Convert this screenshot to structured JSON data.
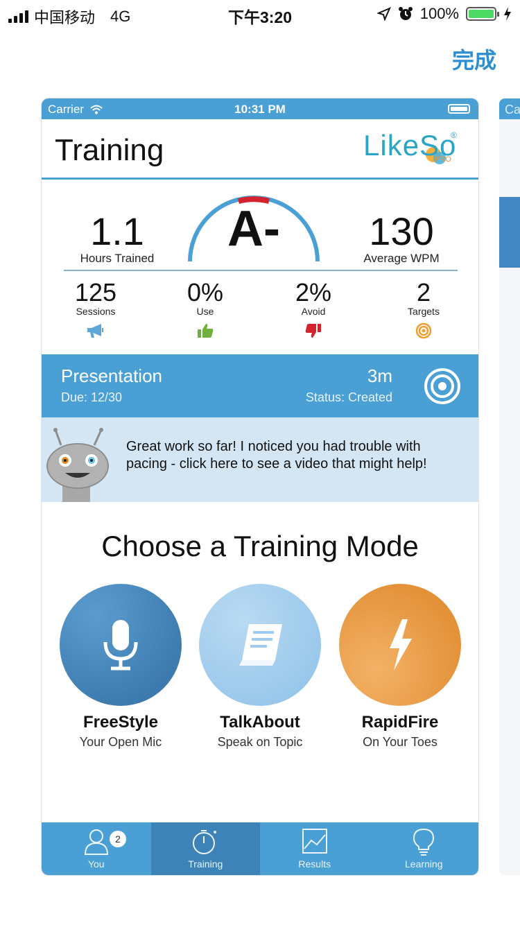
{
  "os_status": {
    "carrier": "中国移动",
    "network": "4G",
    "time": "下午3:20",
    "battery": "100%",
    "battery_level": 1.0
  },
  "nav_done": "完成",
  "app": {
    "status_bar": {
      "carrier": "Carrier",
      "time": "10:31 PM"
    },
    "title": "Training",
    "logo": {
      "text": "LikeSo",
      "badge": "PRO",
      "reg": "®"
    },
    "stats": {
      "hours": {
        "value": "1.1",
        "label": "Hours Trained"
      },
      "grade": "A-",
      "wpm": {
        "value": "130",
        "label": "Average WPM"
      },
      "small": [
        {
          "value": "125",
          "label": "Sessions",
          "icon": "megaphone-icon"
        },
        {
          "value": "0%",
          "label": "Use",
          "icon": "thumbs-up-icon"
        },
        {
          "value": "2%",
          "label": "Avoid",
          "icon": "thumbs-down-icon"
        },
        {
          "value": "2",
          "label": "Targets",
          "icon": "target-icon"
        }
      ]
    },
    "presentation": {
      "title": "Presentation",
      "due": "Due: 12/30",
      "duration": "3m",
      "status": "Status: Created"
    },
    "tip": "Great work so far! I noticed you had trouble with pacing - click here to see a video that might help!",
    "choose_title": "Choose a Training Mode",
    "modes": [
      {
        "name": "FreeStyle",
        "sub": "Your Open Mic",
        "icon": "microphone-icon"
      },
      {
        "name": "TalkAbout",
        "sub": "Speak on Topic",
        "icon": "book-icon"
      },
      {
        "name": "RapidFire",
        "sub": "On Your Toes",
        "icon": "lightning-icon"
      }
    ],
    "tabs": [
      {
        "label": "You",
        "badge": "2",
        "icon": "person-icon"
      },
      {
        "label": "Training",
        "icon": "stopwatch-icon",
        "active": true
      },
      {
        "label": "Results",
        "icon": "chart-icon"
      },
      {
        "label": "Learning",
        "icon": "lightbulb-icon"
      }
    ]
  },
  "peek": {
    "text": "Ca"
  },
  "colors": {
    "primary": "#4a9fd5",
    "active_tab": "#3d83b8",
    "tip_bg": "#d4e6f3",
    "freestyle": "#3f7fb6",
    "talkabout": "#9fcbec",
    "rapidfire": "#e88f2f",
    "grade_red": "#d4232f"
  }
}
